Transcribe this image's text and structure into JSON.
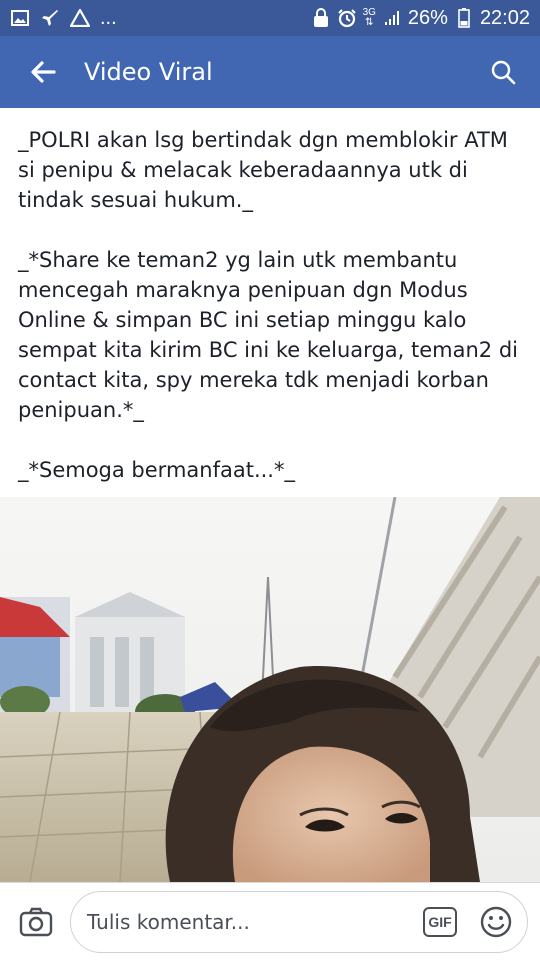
{
  "status_bar": {
    "left_icons": [
      "gallery-icon",
      "airplane-notification-icon",
      "warning-icon"
    ],
    "overflow": "...",
    "right_icons": [
      "alarm-lock-icon",
      "alarm-clock-icon"
    ],
    "network": "3G",
    "battery": "26%",
    "time": "22:02"
  },
  "app_bar": {
    "title": "Video Viral",
    "back_icon": "arrow-left-icon",
    "search_icon": "search-icon"
  },
  "post": {
    "paragraphs": [
      "_POLRI akan lsg bertindak dgn memblokir ATM si penipu & melacak keberadaannya utk di tindak sesuai hukum._",
      "_*Share ke teman2 yg lain utk membantu mencegah maraknya penipuan dgn Modus Online & simpan BC ini setiap minggu kalo sempat kita kirim BC ini ke keluarga, teman2 di contact kita, spy mereka tdk menjadi korban penipuan.*_",
      "_*Semoga bermanfaat...*_"
    ],
    "photo": "selfie photo in front of buildings"
  },
  "comment_bar": {
    "camera_icon": "camera-icon",
    "placeholder": "Tulis komentar...",
    "gif_label": "GIF",
    "emoji_icon": "smiley-icon"
  },
  "colors": {
    "status_bar": "#3b5998",
    "app_bar": "#4267b2",
    "text": "#1d2129"
  }
}
